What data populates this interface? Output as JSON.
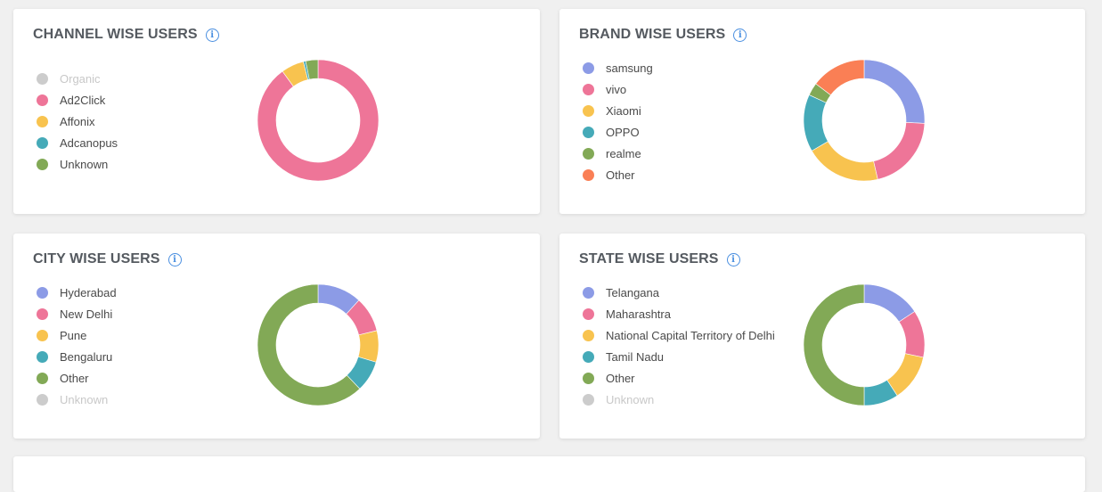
{
  "palette": {
    "purple": "#8c9be6",
    "pink": "#ee7598",
    "yellow": "#f8c34f",
    "teal": "#45aab8",
    "green": "#82a956",
    "orange": "#fa7f55",
    "grey": "#cccccc",
    "info": "#4a8fe0"
  },
  "chart_data": [
    {
      "type": "pie",
      "variant": "donut",
      "title": "CHANNEL WISE USERS",
      "legend_position": "left",
      "slices": [
        {
          "label": "Organic",
          "value": 0,
          "color": "#cccccc",
          "disabled": true
        },
        {
          "label": "Ad2Click",
          "value": 90.0,
          "color": "#ee7598",
          "disabled": false
        },
        {
          "label": "Affonix",
          "value": 6.1,
          "color": "#f8c34f",
          "disabled": false
        },
        {
          "label": "Adcanopus",
          "value": 0.6,
          "color": "#45aab8",
          "disabled": false
        },
        {
          "label": "Unknown",
          "value": 3.3,
          "color": "#82a956",
          "disabled": false
        }
      ]
    },
    {
      "type": "pie",
      "variant": "donut",
      "title": "BRAND WISE USERS",
      "legend_position": "left",
      "slices": [
        {
          "label": "samsung",
          "value": 25.8,
          "color": "#8c9be6",
          "disabled": false
        },
        {
          "label": "vivo",
          "value": 20.6,
          "color": "#ee7598",
          "disabled": false
        },
        {
          "label": "Xiaomi",
          "value": 20.2,
          "color": "#f8c34f",
          "disabled": false
        },
        {
          "label": "OPPO",
          "value": 15.3,
          "color": "#45aab8",
          "disabled": false
        },
        {
          "label": "realme",
          "value": 3.4,
          "color": "#82a956",
          "disabled": false
        },
        {
          "label": "Other",
          "value": 14.7,
          "color": "#fa7f55",
          "disabled": false
        }
      ]
    },
    {
      "type": "pie",
      "variant": "donut",
      "title": "CITY WISE USERS",
      "legend_position": "left",
      "slices": [
        {
          "label": "Hyderabad",
          "value": 11.8,
          "color": "#8c9be6",
          "disabled": false
        },
        {
          "label": "New Delhi",
          "value": 9.4,
          "color": "#ee7598",
          "disabled": false
        },
        {
          "label": "Pune",
          "value": 8.4,
          "color": "#f8c34f",
          "disabled": false
        },
        {
          "label": "Bengaluru",
          "value": 8.3,
          "color": "#45aab8",
          "disabled": false
        },
        {
          "label": "Other",
          "value": 62.1,
          "color": "#82a956",
          "disabled": false
        },
        {
          "label": "Unknown",
          "value": 0,
          "color": "#cccccc",
          "disabled": true
        }
      ]
    },
    {
      "type": "pie",
      "variant": "donut",
      "title": "STATE WISE USERS",
      "legend_position": "left",
      "slices": [
        {
          "label": "Telangana",
          "value": 15.7,
          "color": "#8c9be6",
          "disabled": false
        },
        {
          "label": "Maharashtra",
          "value": 12.6,
          "color": "#ee7598",
          "disabled": false
        },
        {
          "label": "National Capital Territory of Delhi",
          "value": 12.5,
          "color": "#f8c34f",
          "disabled": false
        },
        {
          "label": "Tamil Nadu",
          "value": 9.2,
          "color": "#45aab8",
          "disabled": false
        },
        {
          "label": "Other",
          "value": 50.0,
          "color": "#82a956",
          "disabled": false
        },
        {
          "label": "Unknown",
          "value": 0,
          "color": "#cccccc",
          "disabled": true
        }
      ]
    }
  ],
  "cards": [
    {
      "id": "channel",
      "title": "CHANNEL WISE USERS",
      "info_icon": "info-circle-icon"
    },
    {
      "id": "brand",
      "title": "BRAND WISE USERS",
      "info_icon": "info-circle-icon"
    },
    {
      "id": "city",
      "title": "CITY WISE USERS",
      "info_icon": "info-circle-icon"
    },
    {
      "id": "state",
      "title": "STATE WISE USERS",
      "info_icon": "info-circle-icon"
    }
  ],
  "info_glyph": "i"
}
